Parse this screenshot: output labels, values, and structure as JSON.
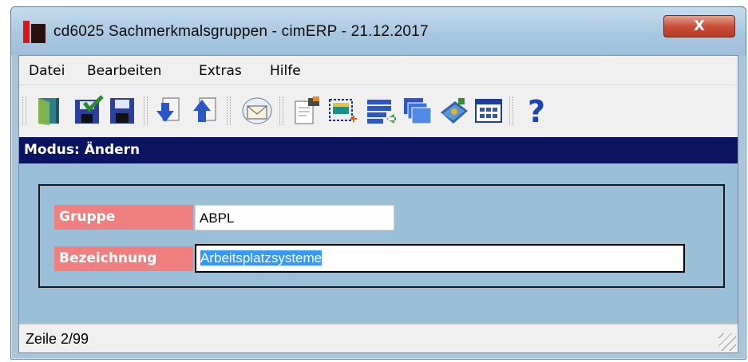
{
  "window": {
    "title": "cd6025 Sachmerkmalsgruppen - cimERP - 21.12.2017",
    "close_glyph": "X"
  },
  "menu": {
    "items": [
      "Datei",
      "Bearbeiten",
      "Extras",
      "Hilfe"
    ]
  },
  "toolbar": {
    "buttons": [
      {
        "icon": "door-exit-icon"
      },
      {
        "icon": "save-checked-icon"
      },
      {
        "icon": "save-icon"
      },
      {
        "icon": "page-down-arrow-icon"
      },
      {
        "icon": "page-up-arrow-icon"
      },
      {
        "icon": "envelope-icon"
      },
      {
        "icon": "edit-document-icon"
      },
      {
        "icon": "new-record-icon"
      },
      {
        "icon": "list-import-icon"
      },
      {
        "icon": "windows-stack-icon"
      },
      {
        "icon": "book-icon"
      },
      {
        "icon": "calendar-grid-icon"
      },
      {
        "icon": "help-question-icon"
      }
    ]
  },
  "mode": {
    "text": "Modus: Ändern"
  },
  "form": {
    "gruppe_label": "Gruppe",
    "gruppe_value": "ABPL",
    "bezeichnung_label": "Bezeichnung",
    "bezeichnung_value": "Arbeitsplatzsysteme"
  },
  "status": {
    "text": "Zeile 2/99"
  },
  "colors": {
    "mode_bar": "#0a1460",
    "label_bg": "#f08080",
    "form_bg": "#9bbfd6"
  }
}
